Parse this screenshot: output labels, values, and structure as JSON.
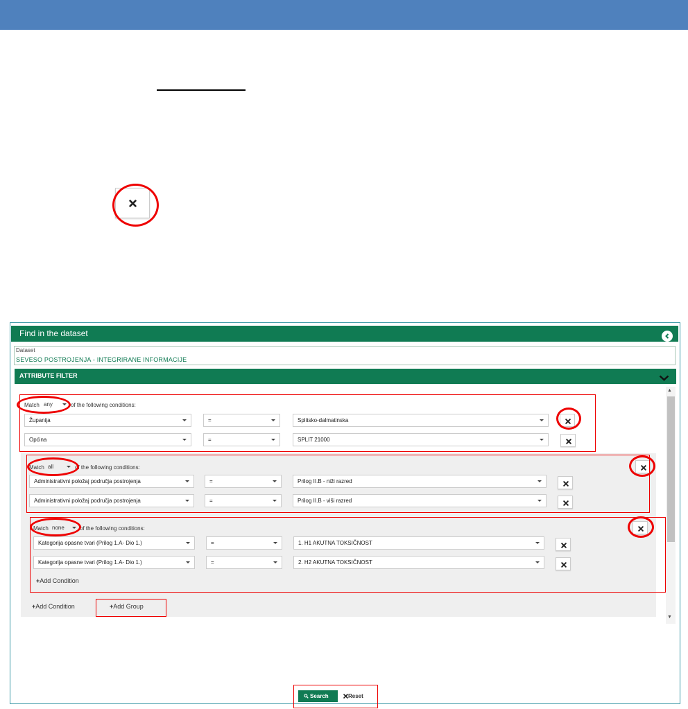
{
  "panel": {
    "title": "Find in the dataset",
    "dataset_label": "Dataset",
    "dataset_value": "SEVESO POSTROJENJA - INTEGRIRANE INFORMACIJE",
    "attribute_filter_title": "ATTRIBUTE FILTER"
  },
  "labels": {
    "match": "Match",
    "following_conditions": "of the following conditions:"
  },
  "groups": [
    {
      "match_value": "any",
      "conditions": [
        {
          "field": "Županija",
          "operator": "=",
          "value": "Splitsko-dalmatinska"
        },
        {
          "field": "Općina",
          "operator": "=",
          "value": "SPLIT 21000"
        }
      ]
    },
    {
      "match_value": "all",
      "conditions": [
        {
          "field": "Administrativni položaj područja postrojenja",
          "operator": "=",
          "value": "Prilog II.B - niži razred"
        },
        {
          "field": "Administrativni položaj područja postrojenja",
          "operator": "=",
          "value": "Prilog II.B - viši razred"
        }
      ]
    },
    {
      "match_value": "none",
      "conditions": [
        {
          "field": "Kategorija opasne tvari (Prilog 1.A- Dio 1.)",
          "operator": "=",
          "value": "1. H1 AKUTNA TOKSIČNOST"
        },
        {
          "field": "Kategorija opasne tvari (Prilog 1.A- Dio 1.)",
          "operator": "=",
          "value": "2. H2 AKUTNA TOKSIČNOST"
        }
      ],
      "add_condition": "Add Condition"
    }
  ],
  "actions": {
    "add_condition": "Add Condition",
    "add_group": "Add Group",
    "search": "Search",
    "reset": "Reset"
  },
  "icons": {
    "close": "close-icon",
    "collapse": "chevron-left-icon",
    "expand": "chevron-down-icon",
    "plus": "plus-icon",
    "search": "search-icon"
  },
  "colors": {
    "header_blue": "#4f81bd",
    "brand_green": "#107b53",
    "annotation_red": "#e00000"
  }
}
